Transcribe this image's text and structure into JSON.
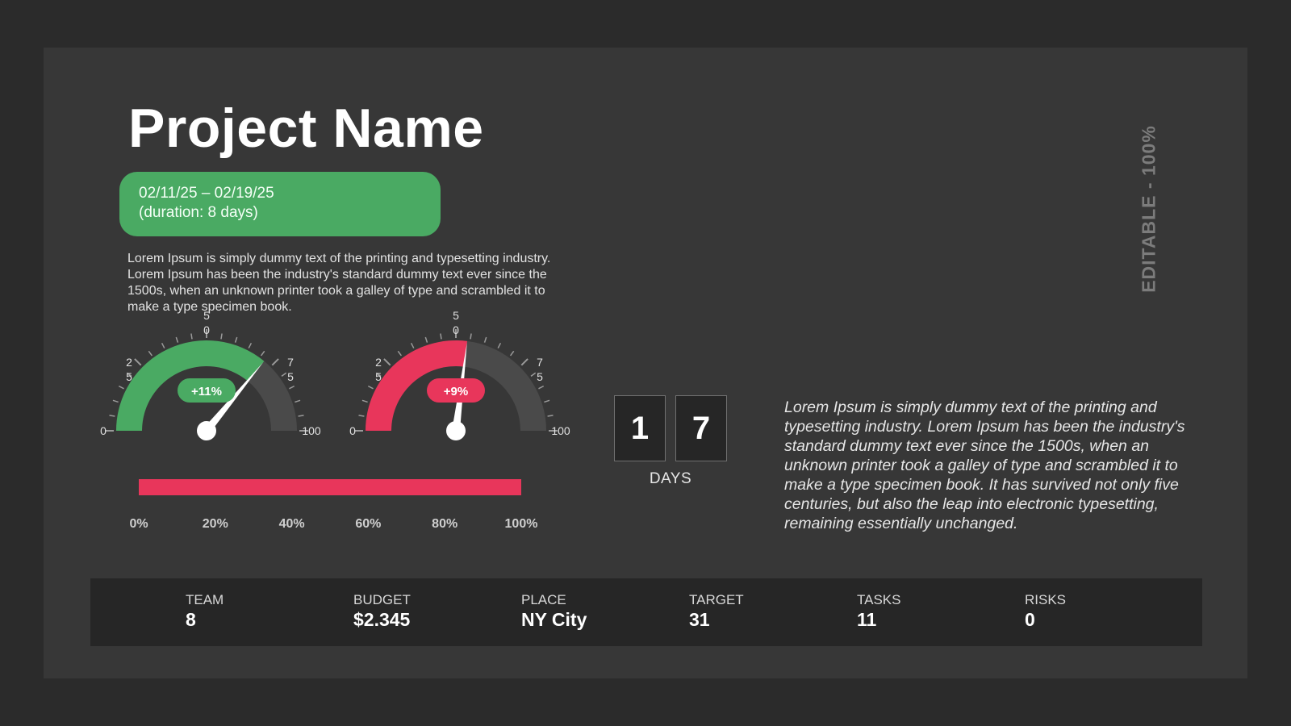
{
  "title": "Project Name",
  "date_range": "02/11/25 – 02/19/25",
  "duration": "(duration: 8 days)",
  "description": "Lorem Ipsum is simply dummy text of the printing and typesetting industry. Lorem Ipsum has been the industry's standard dummy text ever since the 1500s, when an unknown printer took a galley of type and scrambled it to make a type specimen book.",
  "gauges": [
    {
      "badge": "+11%",
      "value": 72,
      "color": "#4aaa63",
      "tick_labels": {
        "min": "0",
        "q1_a": "2",
        "q1_b": "5",
        "mid_a": "5",
        "mid_b": "0",
        "q3_a": "7",
        "q3_b": "5",
        "max": "100"
      }
    },
    {
      "badge": "+9%",
      "value": 54,
      "color": "#e8365b",
      "tick_labels": {
        "min": "0",
        "q1_a": "2",
        "q1_b": "5",
        "mid_a": "5",
        "mid_b": "0",
        "q3_a": "7",
        "q3_b": "5",
        "max": "100"
      }
    }
  ],
  "progress": {
    "fill": 1.0,
    "color": "#e8365b",
    "labels": [
      "0%",
      "20%",
      "40%",
      "60%",
      "80%",
      "100%"
    ]
  },
  "countdown": {
    "digits": [
      "1",
      "7"
    ],
    "label": "DAYS"
  },
  "side_text": "Lorem Ipsum is simply dummy text of the printing and typesetting industry. Lorem Ipsum has been the industry's standard dummy text ever since the 1500s, when an unknown printer took a galley of type and scrambled it to make a type specimen book. It has survived not only five centuries, but also the leap into electronic typesetting, remaining essentially unchanged.",
  "editable_label": "EDITABLE - 100%",
  "stats": [
    {
      "label": "TEAM",
      "value": "8"
    },
    {
      "label": "BUDGET",
      "value": "$2.345"
    },
    {
      "label": "PLACE",
      "value": "NY City"
    },
    {
      "label": "TARGET",
      "value": "31"
    },
    {
      "label": "TASKS",
      "value": "11"
    },
    {
      "label": "RISKS",
      "value": "0"
    }
  ],
  "colors": {
    "background": "#2b2b2b",
    "panel": "#373737",
    "green": "#4aaa63",
    "red": "#e8365b",
    "track": "#4a4a4a"
  }
}
